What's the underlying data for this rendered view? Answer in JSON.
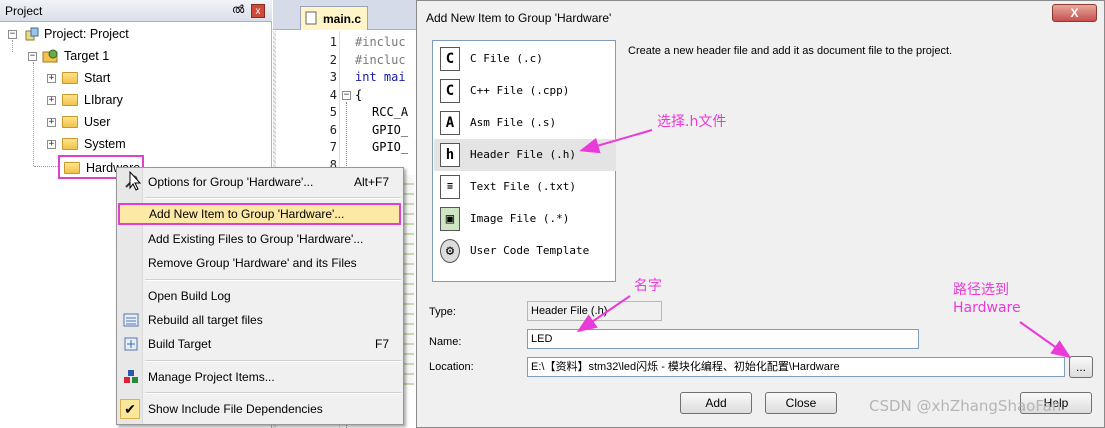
{
  "project_panel": {
    "title": "Project",
    "pin": "ൽ",
    "close": "x",
    "root": "Project: Project",
    "target": "Target 1",
    "groups": [
      "Start",
      "LIbrary",
      "User",
      "System",
      "Hardware"
    ]
  },
  "editor": {
    "tab": "main.c",
    "line_numbers": [
      "1",
      "2",
      "3",
      "4",
      "5",
      "6",
      "7",
      "8"
    ],
    "lines": [
      "#incluc",
      "#incluc",
      "int mai",
      "{",
      "RCC_A",
      "GPIO_",
      "GPIO_",
      ""
    ]
  },
  "context_menu": {
    "items": [
      {
        "label": "Options for Group 'Hardware'...",
        "shortcut": "Alt+F7"
      },
      {
        "label": "Add New  Item to Group 'Hardware'...",
        "shortcut": ""
      },
      {
        "label": "Add Existing Files to Group 'Hardware'...",
        "shortcut": ""
      },
      {
        "label": "Remove Group 'Hardware' and its Files",
        "shortcut": ""
      },
      {
        "label": "Open Build Log",
        "shortcut": ""
      },
      {
        "label": "Rebuild all target files",
        "shortcut": ""
      },
      {
        "label": "Build Target",
        "shortcut": "F7"
      },
      {
        "label": "Manage Project Items...",
        "shortcut": ""
      },
      {
        "label": "Show Include File Dependencies",
        "shortcut": ""
      }
    ],
    "check": "✔"
  },
  "dialog": {
    "title": "Add New Item to Group 'Hardware'",
    "close": "X",
    "file_types": [
      {
        "icon": "C",
        "label": "C File (.c)"
      },
      {
        "icon": "C",
        "label": "C++ File (.cpp)"
      },
      {
        "icon": "A",
        "label": "Asm File (.s)"
      },
      {
        "icon": "h",
        "label": "Header File (.h)"
      },
      {
        "icon": "",
        "label": "Text File (.txt)"
      },
      {
        "icon": "",
        "label": "Image File (.*)"
      },
      {
        "icon": "",
        "label": "User Code Template"
      }
    ],
    "description": "Create a new header file and add it as document file to the project.",
    "type_label": "Type:",
    "type_value": "Header File (.h)",
    "name_label": "Name:",
    "name_value": "LED",
    "location_label": "Location:",
    "location_value": "E:\\【资料】stm32\\led闪烁 - 模块化编程、初始化配置\\Hardware",
    "browse": "...",
    "add": "Add",
    "close_btn": "Close",
    "help": "Help"
  },
  "annotations": {
    "select_h": "选择.h文件",
    "name": "名字",
    "path_line1": "路径选到",
    "path_line2": "Hardware"
  },
  "watermark": "CSDN @xhZhangShaoFan",
  "colors": {
    "annotation": "#ea3ad8",
    "highlight_bg": "#fde9a6",
    "menu_bg": "#f0f0f0"
  }
}
